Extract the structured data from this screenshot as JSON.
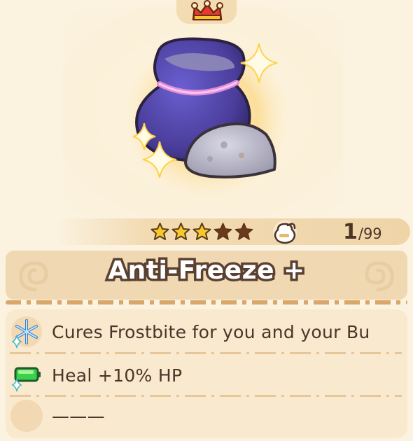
{
  "item": {
    "name": "Anti-Freeze +",
    "rarity_stars": 3,
    "max_stars": 5,
    "count": "1",
    "count_max": "/99",
    "icon": "purple-sack-icon"
  },
  "effects": [
    {
      "icon": "snowflake-icon",
      "text": "Cures Frostbite for you and your Bu"
    },
    {
      "icon": "heal-battery-icon",
      "text": "Heal +10% HP"
    },
    {
      "icon": "empty-slot-icon",
      "text": "———"
    }
  ],
  "colors": {
    "background": "#fbf2e0",
    "title_outline": "#5a4030",
    "text": "#4a3527",
    "star_gold": "#f5c92e",
    "star_brown": "#6b3a1c",
    "sack_purple": "#4a3d9a"
  }
}
